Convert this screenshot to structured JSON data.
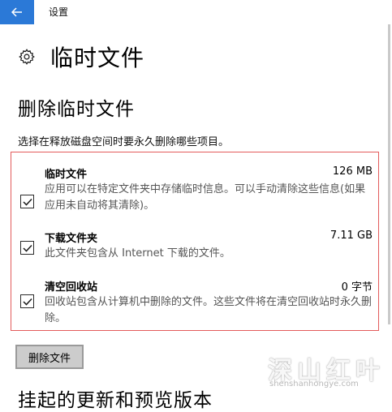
{
  "window": {
    "app_title": "设置"
  },
  "page": {
    "title": "临时文件",
    "icon": "gear-icon"
  },
  "section": {
    "title": "删除临时文件",
    "description": "选择在释放磁盘空间时要永久删除哪些项目。"
  },
  "items": [
    {
      "title": "临时文件",
      "size": "126 MB",
      "checked": true,
      "desc": "应用可以在特定文件夹中存储临时信息。可以手动清除这些信息(如果应用未自动将其清除)。"
    },
    {
      "title": "下载文件夹",
      "size": "7.11 GB",
      "checked": true,
      "desc": "此文件夹包含从 Internet 下载的文件。"
    },
    {
      "title": "清空回收站",
      "size": "0 字节",
      "checked": true,
      "desc": "回收站包含从计算机中删除的文件。这些文件将在清空回收站时永久删除。"
    }
  ],
  "actions": {
    "delete_label": "删除文件"
  },
  "next_section": {
    "title": "挂起的更新和预览版本"
  },
  "watermark": {
    "text": "深山红叶",
    "sub": "shenshanhongye.com"
  },
  "colors": {
    "accent": "#2b79d7",
    "highlight_border": "#e35b5b"
  }
}
